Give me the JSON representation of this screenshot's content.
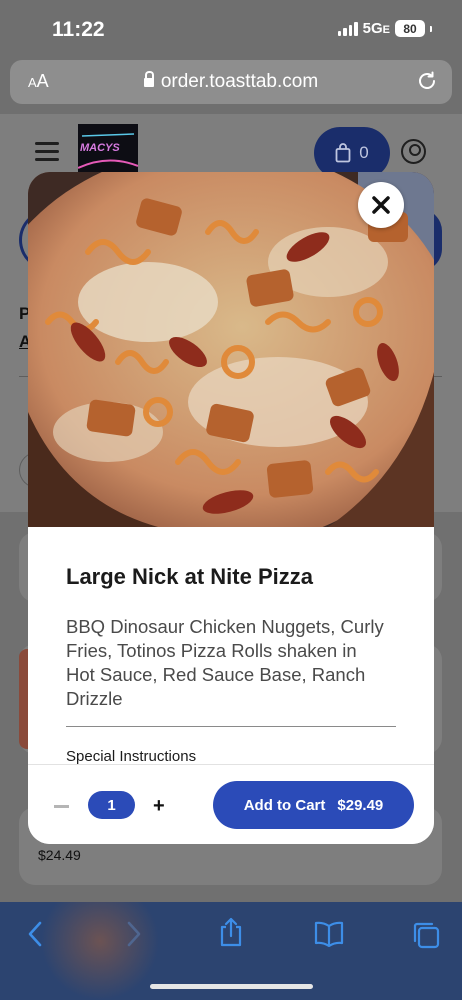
{
  "status_bar": {
    "time": "11:22",
    "network": "5G",
    "network_suffix": "E",
    "battery": "80"
  },
  "browser": {
    "aa_small": "A",
    "aa_large": "A",
    "url": "order.toasttab.com"
  },
  "header": {
    "cart_count": "0",
    "logo_text": "MACYS"
  },
  "background": {
    "partial_heading": "P",
    "partial_link": "A",
    "price": "$24.49"
  },
  "modal": {
    "title": "Large Nick at Nite Pizza",
    "description": "BBQ Dinosaur Chicken Nuggets, Curly Fries, Totinos Pizza Rolls shaken in Hot Sauce, Red Sauce Base, Ranch Drizzle",
    "special_instructions_label": "Special Instructions",
    "quantity": "1",
    "add_to_cart_label": "Add to Cart",
    "price": "$29.49"
  },
  "colors": {
    "accent": "#2b4bb8",
    "toolbar_icons": "#3d8ee8"
  }
}
